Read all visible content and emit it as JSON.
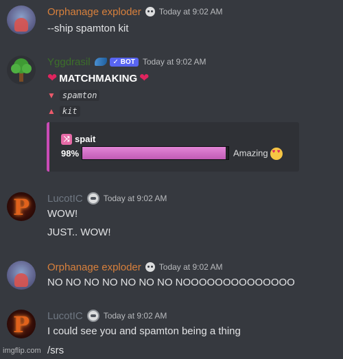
{
  "messages": [
    {
      "author": "Orphanage exploder",
      "timestamp": "Today at 9:02 AM",
      "lines": [
        "--ship spamton kit"
      ]
    },
    {
      "author": "Yggdrasil",
      "bot_tag": "BOT",
      "bot_check": "✓",
      "timestamp": "Today at 9:02 AM",
      "title": "MATCHMAKING",
      "heart_glyph": "❤",
      "down_arrow": "▼",
      "up_arrow": "▲",
      "name_a": "spamton",
      "name_b": "kit",
      "embed": {
        "ship_icon": "⤨",
        "ship_name": "spait",
        "percent_label": "98%",
        "percent_value": 98,
        "verdict": "Amazing",
        "accent": "#c94bb6",
        "bar_color": "#d26fc6"
      }
    },
    {
      "author": "LucotIC",
      "timestamp": "Today at 9:02 AM",
      "lines": [
        "WOW!",
        "JUST.. WOW!"
      ]
    },
    {
      "author": "Orphanage exploder",
      "timestamp": "Today at 9:02 AM",
      "lines": [
        "NO NO NO NO NO NO NO NOOOOOOOOOOOOOO"
      ]
    },
    {
      "author": "LucotIC",
      "timestamp": "Today at 9:02 AM",
      "lines": [
        "I could see you and spamton being a thing",
        "/srs"
      ]
    }
  ],
  "avatar_letter": "P",
  "watermark": "imgflip.com",
  "colors": {
    "background": "#36393f",
    "orange_name": "#d8803c",
    "bot_name": "#3c6f2a",
    "gray_name": "#6f7782",
    "heart": "#e0245e"
  },
  "icons": {
    "skull_badge": "skull-icon",
    "wing_badge": "wing-icon",
    "ship_badge": "shuffle-icon",
    "emoji": "heart-eyes-icon"
  }
}
